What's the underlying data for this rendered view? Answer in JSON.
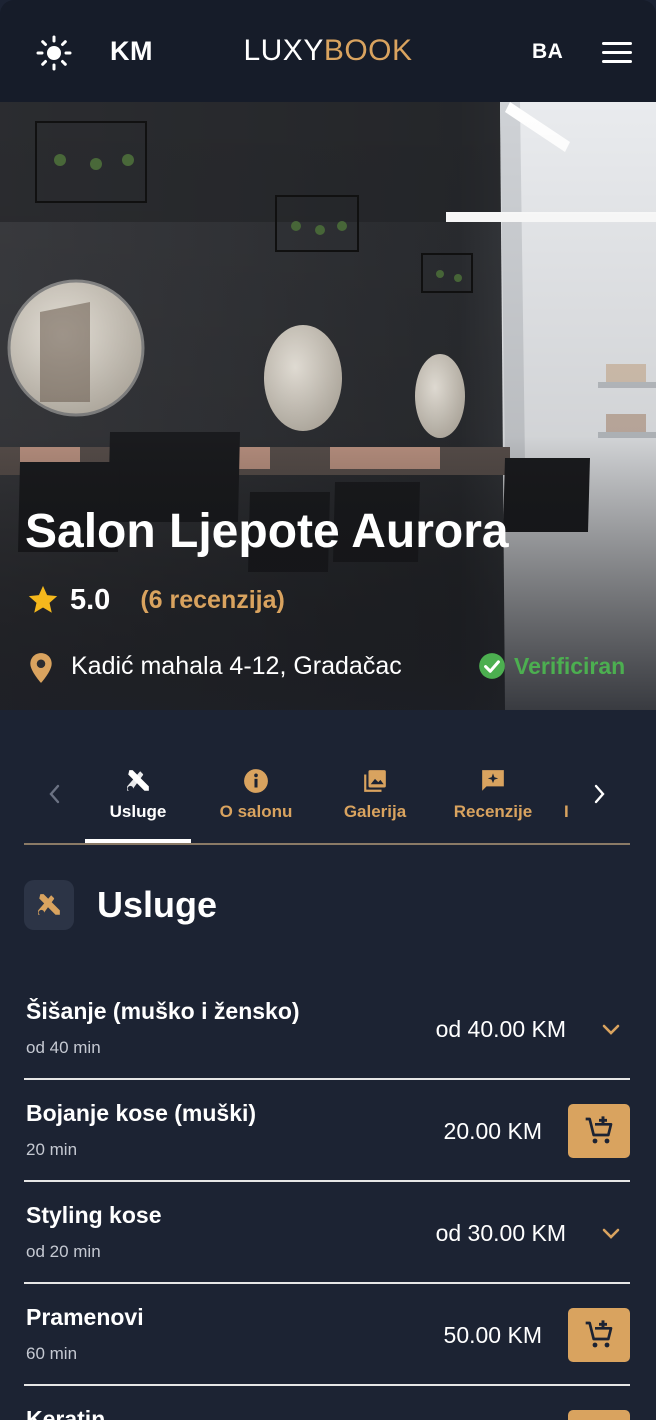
{
  "header": {
    "currency": "KM",
    "brand_part1": "LUXY",
    "brand_part2": "BOOK",
    "language": "BA",
    "colors": {
      "accent": "#d9a35f",
      "background": "#161c29"
    }
  },
  "hero": {
    "salon_name": "Salon Ljepote Aurora",
    "rating": "5.0",
    "reviews": "(6 recenzija)",
    "address": "Kadić mahala 4-12, Gradačac",
    "verified": "Verificiran",
    "verified_color": "#4caf50"
  },
  "tabs": {
    "items": [
      {
        "label": "Usluge",
        "icon": "scissors-ruler-icon",
        "active": true
      },
      {
        "label": "O salonu",
        "icon": "info-icon",
        "active": false
      },
      {
        "label": "Galerija",
        "icon": "gallery-icon",
        "active": false
      },
      {
        "label": "Recenzije",
        "icon": "review-icon",
        "active": false
      }
    ],
    "overflow_label": "I"
  },
  "section": {
    "title": "Usluge"
  },
  "services": [
    {
      "name": "Šišanje (muško i žensko)",
      "duration": "od 40 min",
      "price": "od 40.00 KM",
      "action": "expand"
    },
    {
      "name": "Bojanje kose (muški)",
      "duration": "20 min",
      "price": "20.00 KM",
      "action": "cart"
    },
    {
      "name": "Styling kose",
      "duration": "od 20 min",
      "price": "od 30.00 KM",
      "action": "expand"
    },
    {
      "name": "Pramenovi",
      "duration": "60 min",
      "price": "50.00 KM",
      "action": "cart"
    },
    {
      "name": "Keratin",
      "duration": "",
      "price": "",
      "action": "cart"
    }
  ]
}
